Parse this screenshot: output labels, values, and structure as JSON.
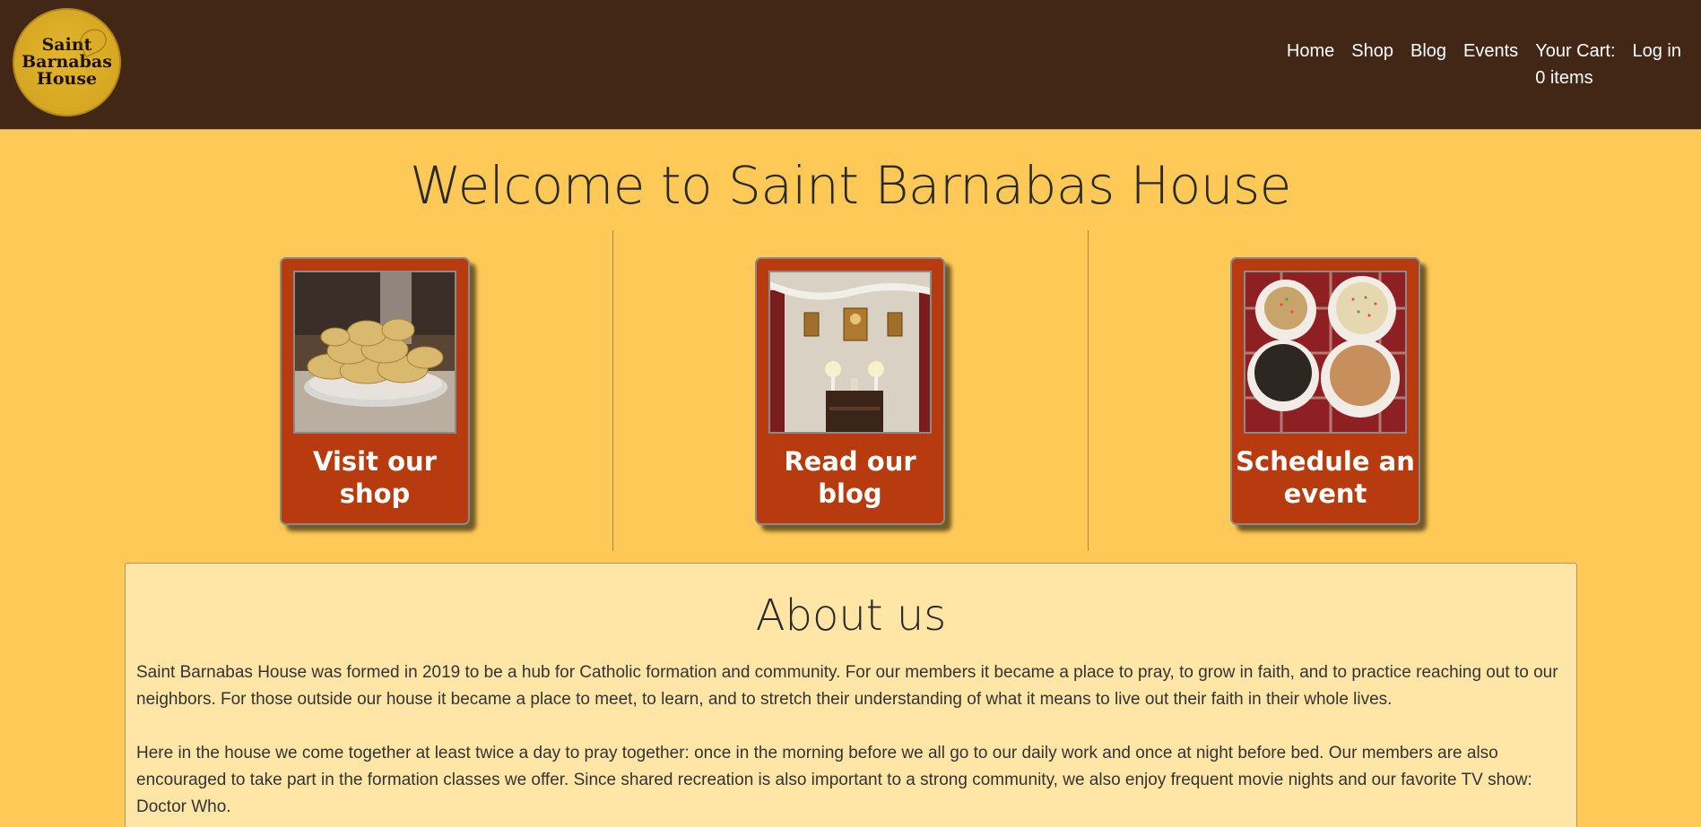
{
  "header": {
    "logo_lines": [
      "Saint",
      "Barnabas",
      "House"
    ],
    "nav": [
      "Home",
      "Shop",
      "Blog",
      "Events"
    ],
    "cart_label": "Your Cart:",
    "cart_count": "0 items",
    "login": "Log in"
  },
  "welcome_title": "Welcome to Saint Barnabas House",
  "cards": [
    {
      "line1": "Visit our",
      "line2": "shop",
      "image": "scones-photo"
    },
    {
      "line1": "Read our",
      "line2": "blog",
      "image": "icon-altar-photo"
    },
    {
      "line1": "Schedule an",
      "line2": "event",
      "image": "cakes-photo"
    }
  ],
  "about": {
    "title": "About us",
    "p1": "Saint Barnabas House was formed in 2019 to be a hub for Catholic formation and community. For our members it became a place to pray, to grow in faith, and to practice reaching out to our neighbors. For those outside our house it became a place to meet, to learn, and to stretch their understanding of what it means to live out their faith in their whole lives.",
    "p2": "Here in the house we come together at least twice a day to pray together: once in the morning before we all go to our daily work and once at night before bed. Our members are also encouraged to take part in the formation classes we offer. Since shared recreation is also important to a strong community, we also enjoy frequent movie nights and our favorite TV show: Doctor Who."
  },
  "colors": {
    "header_bg": "#432716",
    "page_bg": "#fec956",
    "card_bg": "#b83a0f",
    "about_bg": "#ffe6a7"
  }
}
